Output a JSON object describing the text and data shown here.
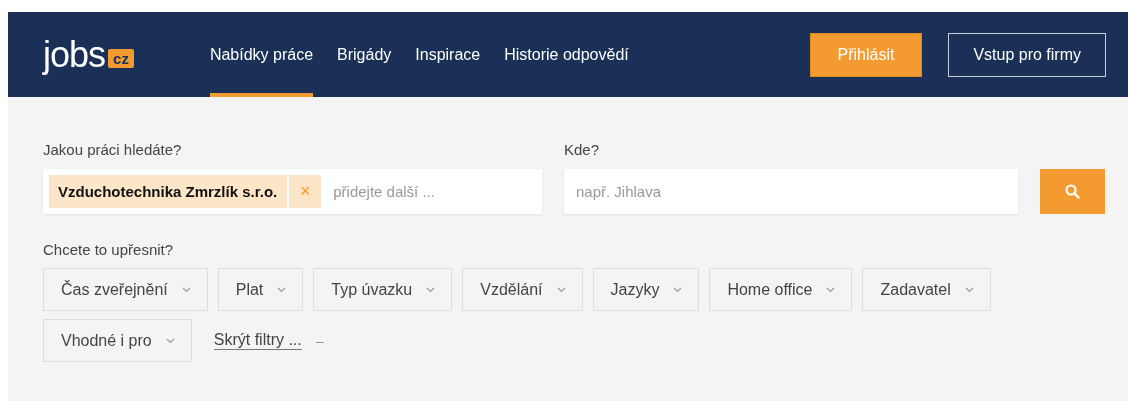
{
  "header": {
    "logo": {
      "text": "jobs",
      "badge": "cz"
    },
    "tabs": [
      {
        "label": "Nabídky práce",
        "selected": true
      },
      {
        "label": "Brigády",
        "selected": false
      },
      {
        "label": "Inspirace",
        "selected": false
      },
      {
        "label": "Historie odpovědí",
        "selected": false
      }
    ],
    "buttons": [
      {
        "label": "Přihlásit",
        "kind": "primary"
      },
      {
        "label": "Vstup pro firmy",
        "kind": "outline"
      }
    ]
  },
  "search": {
    "what": {
      "label": "Jakou práci hledáte?",
      "tokens": [
        "Vzduchotechnika Zmrzlík s.r.o."
      ],
      "remove_symbol": "×",
      "placeholder": "přidejte další ..."
    },
    "where": {
      "label": "Kde?",
      "placeholder": "např. Jihlava"
    }
  },
  "filters": {
    "label": "Chcete to upřesnit?",
    "items": [
      "Čas zveřejnění",
      "Plat",
      "Typ úvazku",
      "Vzdělání",
      "Jazyky",
      "Home office",
      "Zadavatel",
      "Vhodné i pro"
    ],
    "hide_link": "Skrýt filtry ...",
    "hide_symbol": "–"
  }
}
